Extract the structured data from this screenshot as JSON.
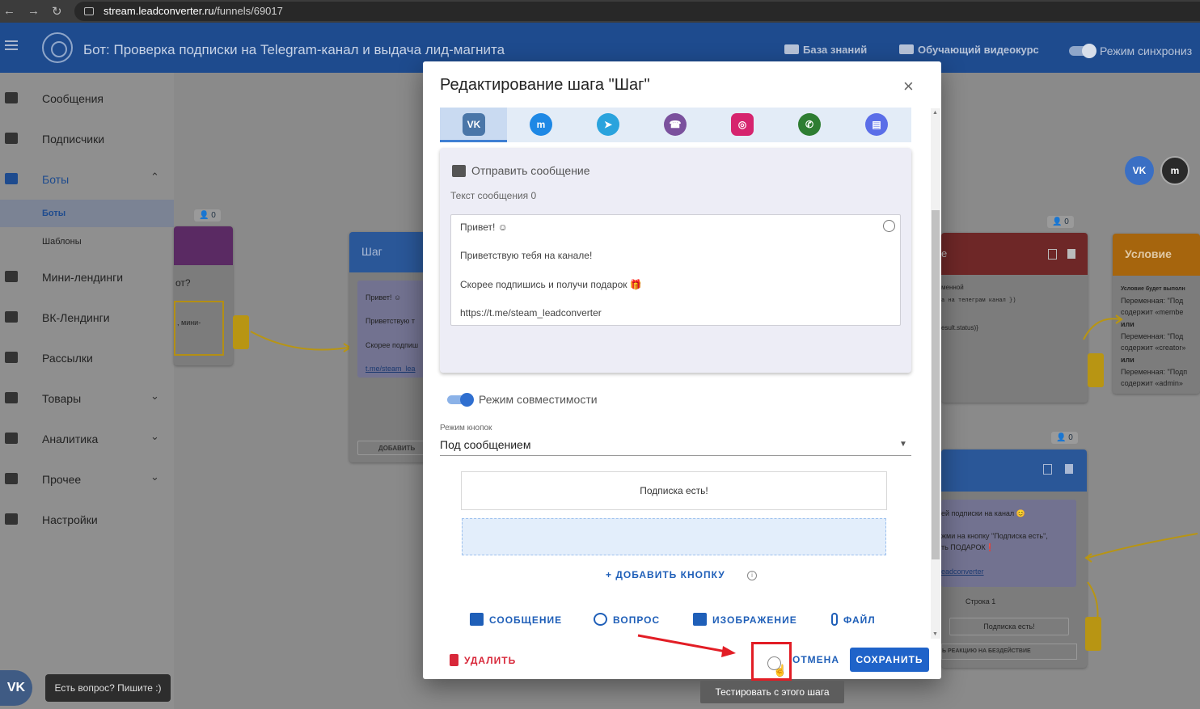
{
  "browser": {
    "url_host": "stream.leadconverter.ru",
    "url_path": "/funnels/69017",
    "back": "←",
    "forward": "→",
    "reload": "↻"
  },
  "header": {
    "title": "Бот: Проверка подписки на Telegram-канал и выдача лид-магнита",
    "knowledge_base": "База знаний",
    "video_course": "Обучающий видеокурс",
    "sync_mode": "Режим синхрониз"
  },
  "sidebar": {
    "items": [
      {
        "label": "Сообщения",
        "icon": "chat-icon"
      },
      {
        "label": "Подписчики",
        "icon": "people-icon"
      },
      {
        "label": "Боты",
        "icon": "android-icon",
        "chevron": "⌃"
      },
      {
        "label": "Мини-лендинги",
        "icon": "window-icon"
      },
      {
        "label": "ВК-Лендинги",
        "icon": "card-icon"
      },
      {
        "label": "Рассылки",
        "icon": "send-icon"
      },
      {
        "label": "Товары",
        "icon": "dollar-icon",
        "chevron": "⌄"
      },
      {
        "label": "Аналитика",
        "icon": "chart-icon",
        "chevron": "⌄"
      },
      {
        "label": "Прочее",
        "icon": "more-icon",
        "chevron": "⌄"
      },
      {
        "label": "Настройки",
        "icon": "gear-icon"
      }
    ],
    "subitems": [
      "Боты",
      "Шаблоны"
    ]
  },
  "canvas": {
    "left_node_counter": "0",
    "left_node_text_1": "от?",
    "left_node_text_2": ", мини-",
    "step_node_title": "Шаг",
    "step_node_lines": [
      "Привет! ☺",
      "Приветствую т",
      "Скорее подпиш",
      "t.me/steam_lea"
    ],
    "step_node_add": "ДОБАВИТЬ",
    "right_node_counter": "0",
    "right_node_title": "е",
    "right_node_lines": [
      "менной",
      "а на телеграм канал })",
      "esult.status)}"
    ],
    "condition_title": "Условие",
    "condition_lines": [
      "Условие будет выполн",
      "Переменная: \"Под",
      "содержит «membe",
      "или",
      "Переменная: \"Под",
      "содержит «creator»",
      "или",
      "Переменная: \"Подп",
      "содержит «admin»"
    ],
    "lower_node_counter": "0",
    "lower_node_lines": [
      "ей подписки на канал 😊",
      "жми на кнопку \"Подписка есть\",",
      "ть ПОДАРОК❗",
      "eadconverter"
    ],
    "lower_node_row": "Строка 1",
    "lower_node_button": "Подписка есть!",
    "lower_node_reaction": "Ь РЕАКЦИЮ НА БЕЗДЕЙСТВИЕ"
  },
  "modal": {
    "title": "Редактирование шага \"Шаг\"",
    "close": "×",
    "messengers": [
      {
        "name": "vk",
        "glyph": "VK",
        "color": "#4a76a8"
      },
      {
        "name": "messenger",
        "glyph": "m",
        "color": "#1e88e5"
      },
      {
        "name": "telegram",
        "glyph": "➤",
        "color": "#2aa3dd"
      },
      {
        "name": "viber",
        "glyph": "☎",
        "color": "#7b519d"
      },
      {
        "name": "instagram",
        "glyph": "◎",
        "color": "#d6246e"
      },
      {
        "name": "whatsapp",
        "glyph": "✆",
        "color": "#2e7d32"
      },
      {
        "name": "chat",
        "glyph": "▤",
        "color": "#5b6ee8"
      }
    ],
    "card_title": "Отправить сообщение",
    "text_length_label": "Текст сообщения 0",
    "message_lines": [
      "Привет! ☺",
      "Приветствую тебя на канале!",
      "Скорее подпишись и получи подарок 🎁",
      "https://t.me/steam_leadconverter"
    ],
    "compat_mode": "Режим совместимости",
    "button_mode_label": "Режим кнопок",
    "button_mode_value": "Под сообщением",
    "keyboard_button": "Подписка есть!",
    "add_button": "+ ДОБАВИТЬ КНОПКУ",
    "add_info": "i",
    "actions": [
      "СООБЩЕНИЕ",
      "ВОПРОС",
      "ИЗОБРАЖЕНИЕ",
      "ФАЙЛ"
    ],
    "delete": "УДАЛИТЬ",
    "cancel": "ОТМЕНА",
    "save": "СОХРАНИТЬ"
  },
  "tooltip": "Тестировать с этого шага",
  "chat_widget": {
    "logo": "VK",
    "tip": "Есть вопрос? Пишите :)"
  },
  "floating": [
    {
      "glyph": "VK",
      "color": "#3a6fc4"
    },
    {
      "glyph": "m",
      "color": "#2a2a2a"
    }
  ],
  "colors": {
    "primary": "#1f63c9",
    "danger": "#d8283a",
    "highlight": "#e21d25",
    "header": "#1e4b8e"
  }
}
